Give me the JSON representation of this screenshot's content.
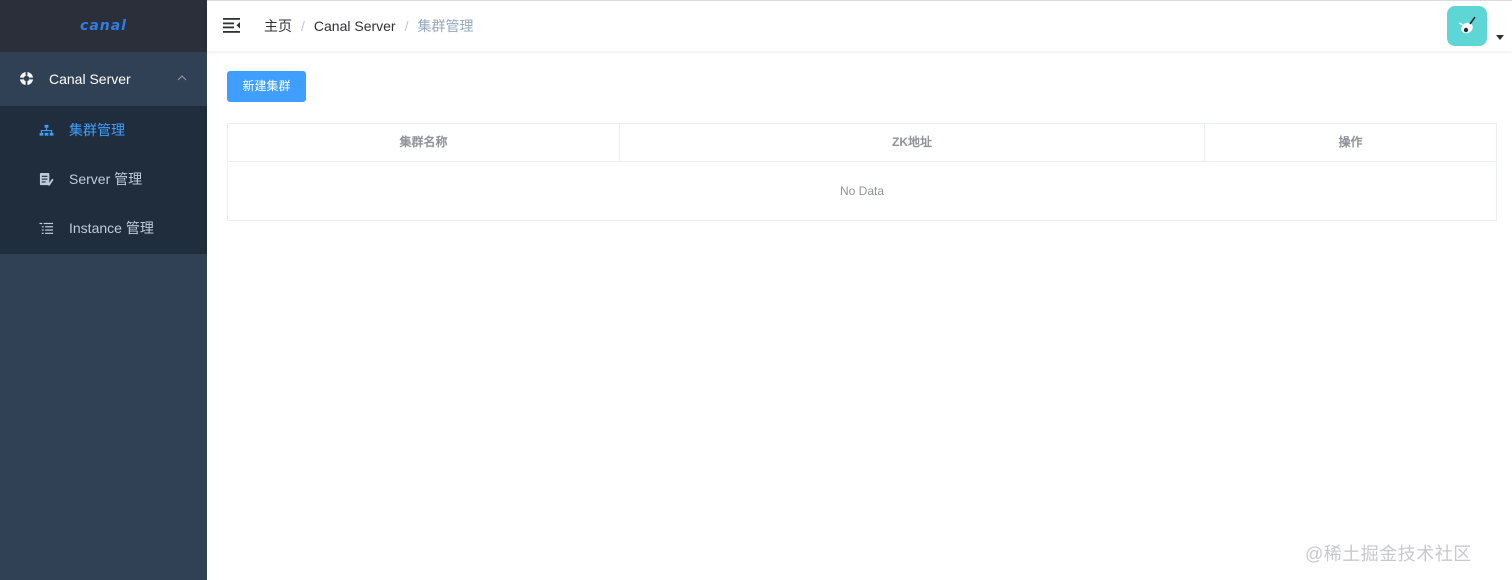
{
  "sidebar": {
    "logo": "canal",
    "menu": {
      "label": "Canal Server",
      "icon": "lifebuoy-icon",
      "expanded": true,
      "items": [
        {
          "label": "集群管理",
          "icon": "sitemap-icon",
          "active": true
        },
        {
          "label": "Server 管理",
          "icon": "document-edit-icon",
          "active": false
        },
        {
          "label": "Instance 管理",
          "icon": "list-icon",
          "active": false
        }
      ]
    }
  },
  "header": {
    "breadcrumb": [
      "主页",
      "Canal Server",
      "集群管理"
    ],
    "separator": "/"
  },
  "main": {
    "new_button": "新建集群",
    "table": {
      "columns": [
        "集群名称",
        "ZK地址",
        "操作"
      ],
      "rows": [],
      "empty_text": "No Data"
    }
  },
  "watermark": "@稀土掘金技术社区",
  "colors": {
    "primary": "#409eff",
    "sidebar_bg": "#304156",
    "submenu_bg": "#1f2d3d",
    "logo_bar_bg": "#2b2f3a",
    "avatar_bg": "#5fd6d6"
  }
}
